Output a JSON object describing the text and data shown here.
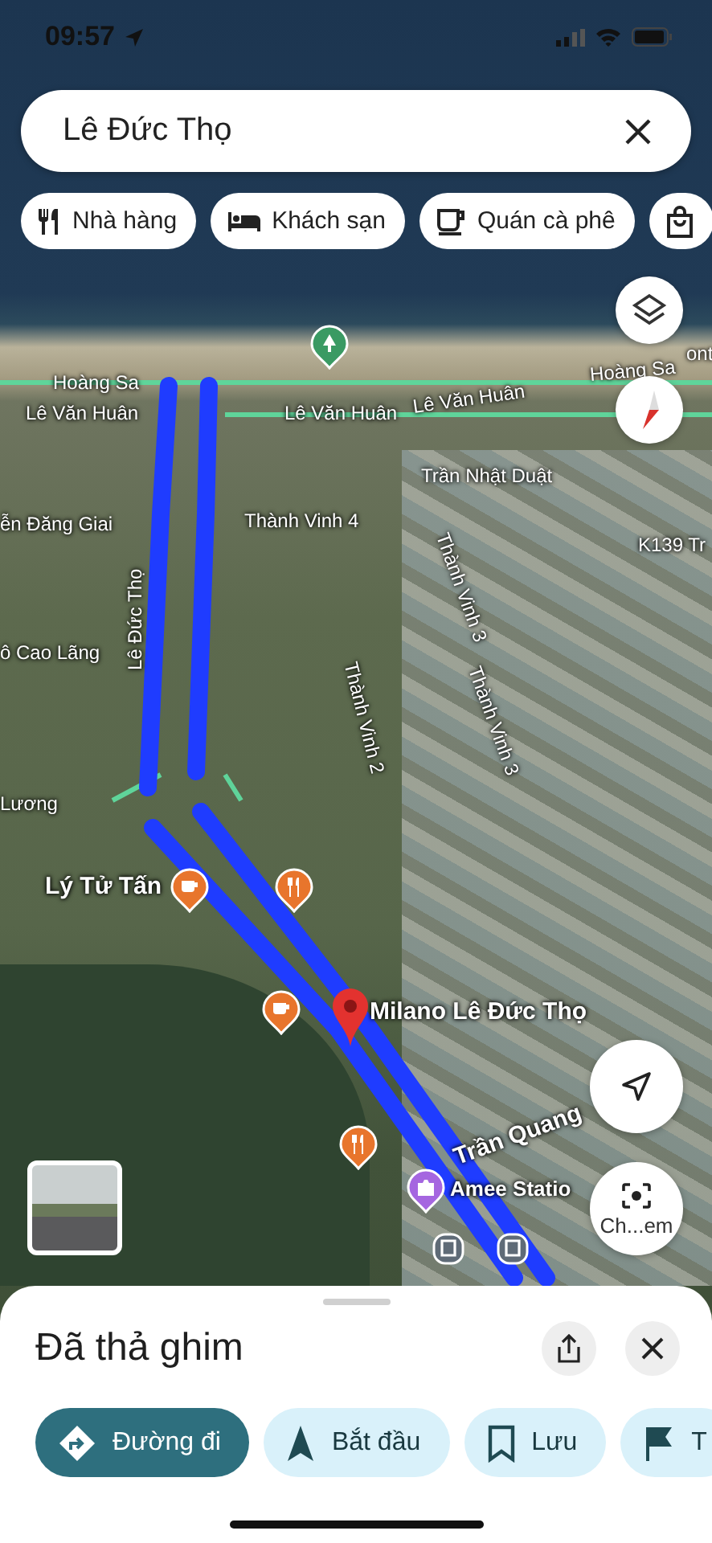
{
  "status_bar": {
    "time": "09:57"
  },
  "search": {
    "value": "Lê Đức Thọ"
  },
  "category_chips": [
    {
      "kind": "restaurant",
      "label": "Nhà hàng"
    },
    {
      "kind": "hotel",
      "label": "Khách sạn"
    },
    {
      "kind": "cafe",
      "label": "Quán cà phê"
    },
    {
      "kind": "shopping"
    }
  ],
  "map": {
    "labels": [
      {
        "text": "Hoàng Sa"
      },
      {
        "text": "Lê Văn Huân"
      },
      {
        "text": "Lê Văn Huân"
      },
      {
        "text": "Lê Văn Huân"
      },
      {
        "text": "Hoàng Sa"
      },
      {
        "text": "ont"
      },
      {
        "text": "Trần Nhật Duật"
      },
      {
        "text": "Thành Vinh 4"
      },
      {
        "text": "ễn Đăng Giai"
      },
      {
        "text": "Lê Đức Thọ"
      },
      {
        "text": "ô Cao Lãng"
      },
      {
        "text": "Thành Vinh 3"
      },
      {
        "text": "Thành Vinh 2"
      },
      {
        "text": "Thành Vinh 3"
      },
      {
        "text": "K139 Tr"
      },
      {
        "text": "Lương"
      },
      {
        "text": "Lý Tử Tấn"
      },
      {
        "text": "Milano Lê Đức Thọ"
      },
      {
        "text": "Trần Quang"
      },
      {
        "text": "Amee Statio"
      }
    ],
    "places": [
      {
        "kind": "park"
      },
      {
        "kind": "cafe"
      },
      {
        "kind": "restaurant"
      },
      {
        "kind": "cafe"
      },
      {
        "kind": "restaurant"
      },
      {
        "kind": "photo"
      },
      {
        "kind": "bus"
      },
      {
        "kind": "bus"
      }
    ],
    "lens_label": "Ch...em"
  },
  "sheet": {
    "title": "Đã thả ghim",
    "actions": [
      {
        "kind": "primary",
        "label": "Đường đi"
      },
      {
        "kind": "secondary",
        "label": "Bắt đầu"
      },
      {
        "kind": "secondary",
        "label": "Lưu"
      },
      {
        "kind": "secondary",
        "label": "T"
      }
    ]
  }
}
